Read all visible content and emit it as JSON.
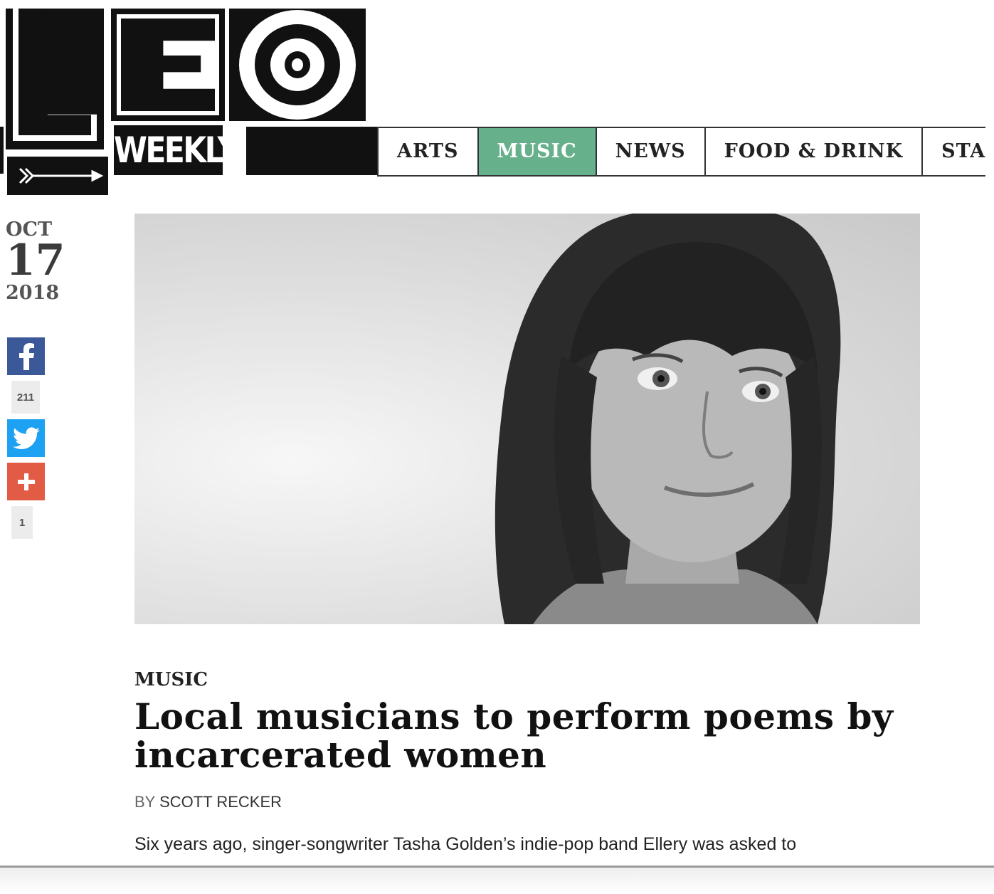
{
  "logo": {
    "weekly_text": "WEEKLY"
  },
  "nav": {
    "items": [
      {
        "label": "ARTS"
      },
      {
        "label": "MUSIC"
      },
      {
        "label": "NEWS"
      },
      {
        "label": "FOOD & DRINK"
      },
      {
        "label": "STA"
      }
    ],
    "active": "MUSIC",
    "active_color": "#67b08c"
  },
  "date": {
    "month": "OCT",
    "day": "17",
    "year": "2018"
  },
  "social": {
    "facebook_icon": "facebook-icon",
    "facebook_count": "211",
    "twitter_icon": "twitter-icon",
    "share_icon": "plus-icon",
    "share_count": "1",
    "colors": {
      "facebook": "#3b5998",
      "twitter": "#1da1f2",
      "share": "#e25b45"
    }
  },
  "article": {
    "category": "MUSIC",
    "title": "Local musicians to perform poems by incarcerated women",
    "byline_prefix": "BY",
    "author": "SCOTT RECKER",
    "lead": "Six years ago, singer-songwriter Tasha Golden’s indie-pop band Ellery was asked to"
  }
}
